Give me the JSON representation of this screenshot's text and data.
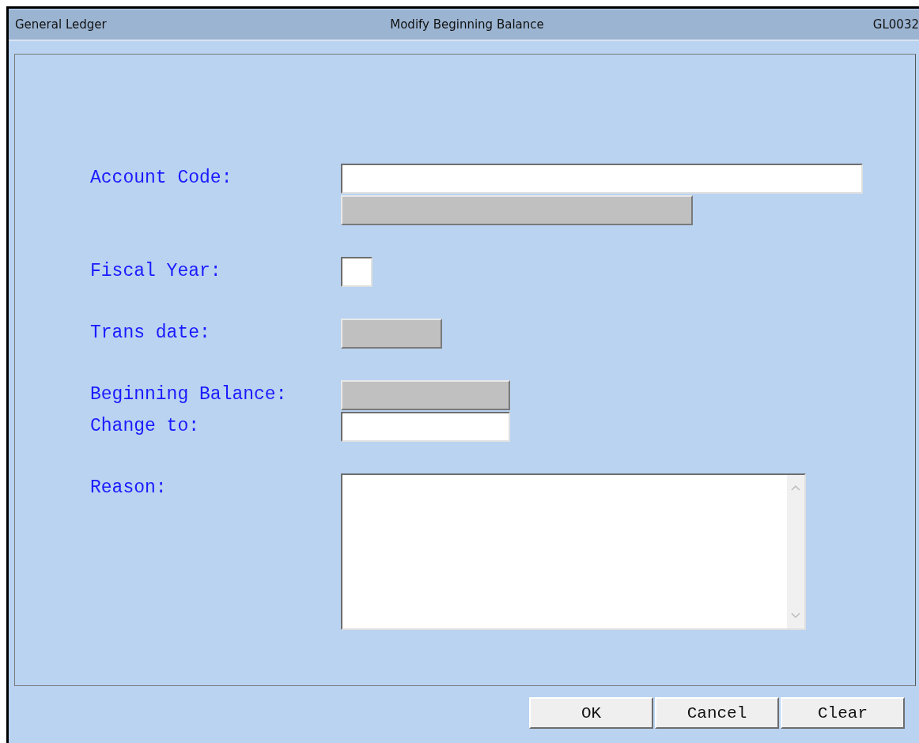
{
  "window": {
    "title_left": "General Ledger",
    "title": "Modify Beginning Balance",
    "title_right": "GL0032"
  },
  "form": [
    {
      "label": "Account Code:",
      "fields": [
        {
          "kind": "text",
          "disabled": false
        },
        {
          "kind": "text",
          "disabled": true
        }
      ]
    },
    {
      "label": "Fiscal Year:",
      "fields": [
        {
          "kind": "text",
          "disabled": false
        }
      ]
    },
    {
      "label": "Trans date:",
      "fields": [
        {
          "kind": "text",
          "disabled": true
        }
      ]
    },
    {
      "label": "Beginning Balance:",
      "fields": [
        {
          "kind": "text",
          "disabled": true
        }
      ]
    },
    {
      "label": "Change to:",
      "fields": [
        {
          "kind": "text",
          "disabled": false
        }
      ]
    },
    {
      "label": "Reason:",
      "fields": [
        {
          "kind": "textarea",
          "disabled": false
        }
      ]
    }
  ],
  "buttons": [
    "OK",
    "Cancel",
    "Clear"
  ]
}
